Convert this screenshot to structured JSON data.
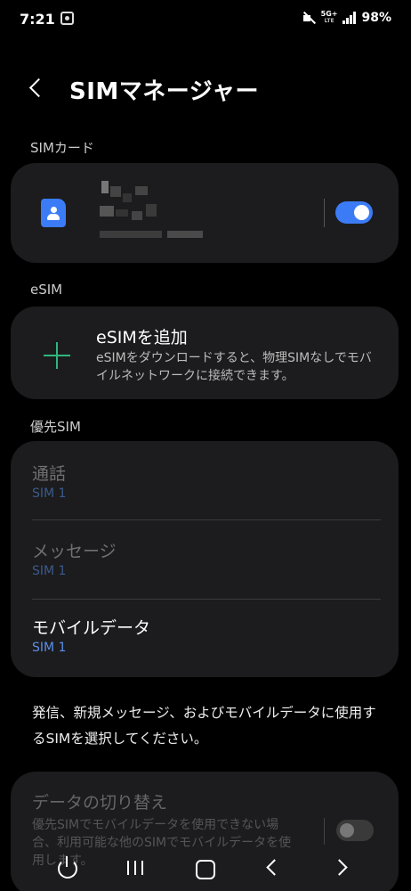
{
  "status_bar": {
    "time": "7:21",
    "network": "5G+",
    "network_sub": "LTE",
    "battery": "98%"
  },
  "header": {
    "title": "SIMマネージャー"
  },
  "sim_section": {
    "label": "SIMカード",
    "sim_enabled": true
  },
  "esim_section": {
    "label": "eSIM",
    "add_title": "eSIMを追加",
    "add_description": "eSIMをダウンロードすると、物理SIMなしでモバイルネットワークに接続できます。"
  },
  "preferred_section": {
    "label": "優先SIM",
    "rows": [
      {
        "title": "通話",
        "value": "SIM 1",
        "enabled": false
      },
      {
        "title": "メッセージ",
        "value": "SIM 1",
        "enabled": false
      },
      {
        "title": "モバイルデータ",
        "value": "SIM 1",
        "enabled": true
      }
    ]
  },
  "footer_note": "発信、新規メッセージ、およびモバイルデータに使用するSIMを選択してください。",
  "data_switching": {
    "title": "データの切り替え",
    "description": "優先SIMでモバイルデータを使用できない場合、利用可能な他のSIMでモバイルデータを使用します。",
    "enabled": false
  },
  "colors": {
    "accent": "#3b7cf6",
    "accent_text": "#5b8fe8",
    "disabled_text": "#6f6f74",
    "disabled_accent": "#3b5a8c",
    "plus_green": "#2fb77e"
  },
  "nav_bar": {
    "icons": [
      "power-icon",
      "recent-apps-icon",
      "home-icon",
      "back-icon",
      "forward-icon"
    ]
  }
}
